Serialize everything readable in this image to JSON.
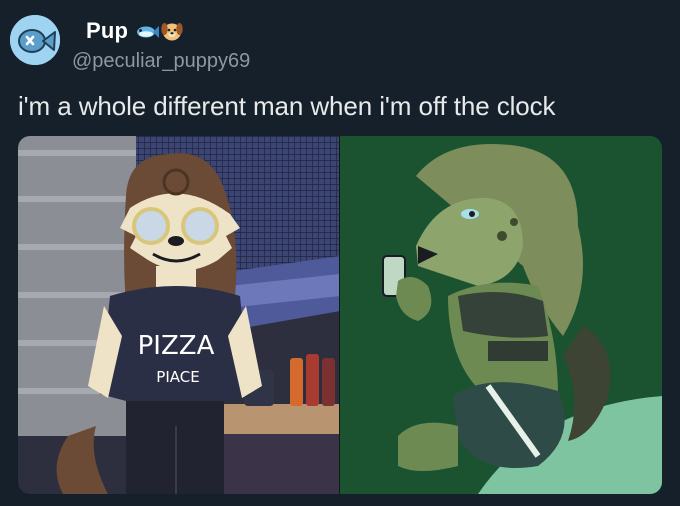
{
  "tweet": {
    "author": {
      "display_name": "Pup",
      "handle": "@peculiar_puppy69",
      "name_emojis": [
        "fish-icon",
        "dog-face-icon"
      ]
    },
    "text": "i'm a whole different man when i'm off the clock",
    "media": {
      "left_panel": {
        "shirt_text_line1": "PIZZA",
        "shirt_text_line2": "PIACE"
      },
      "right_panel": {}
    }
  },
  "colors": {
    "background": "#15202b",
    "primary_text": "#e7e9ea",
    "secondary_text": "#8b98a5",
    "avatar_bg": "#9fd3f2",
    "right_panel_green": "#1e5a35"
  }
}
